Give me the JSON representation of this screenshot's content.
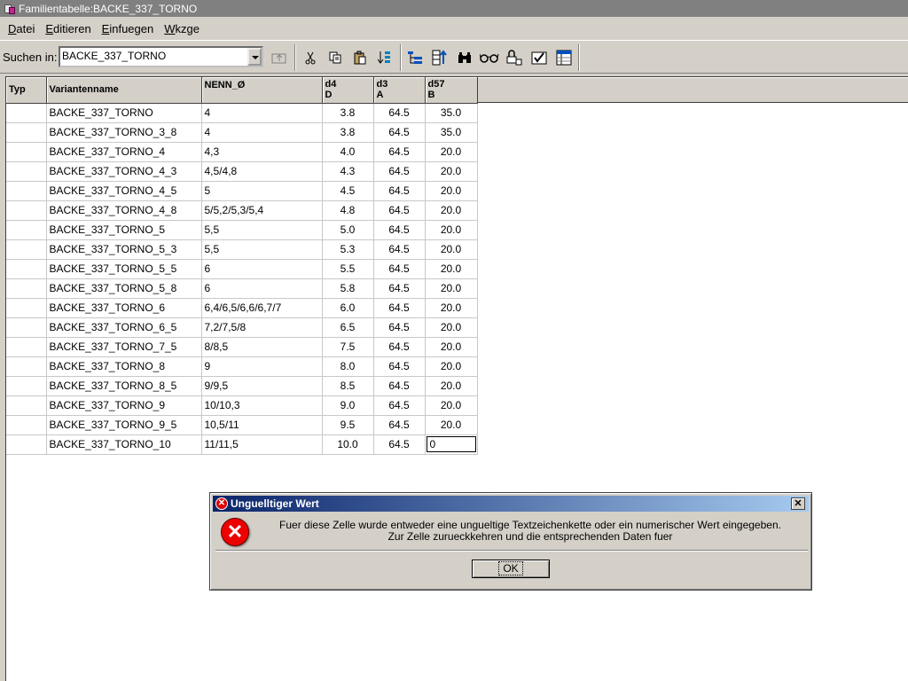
{
  "window": {
    "title": "Familientabelle:BACKE_337_TORNO"
  },
  "menu": [
    {
      "label": "Datei"
    },
    {
      "label": "Editieren"
    },
    {
      "label": "Einfuegen"
    },
    {
      "label": "Wkzge"
    }
  ],
  "toolbar": {
    "search_label": "Suchen in:",
    "search_value": "BACKE_337_TORNO",
    "icons": [
      "folder-up-icon",
      "cut-icon",
      "copy-icon",
      "paste-icon",
      "fill-down-icon",
      "tree-icon",
      "sort-icon",
      "binoculars-icon",
      "glasses-icon",
      "lock-icon",
      "verify-icon",
      "table-icon"
    ]
  },
  "table": {
    "headers": {
      "typ": "Typ",
      "name": "Variantenname",
      "nenn": "NENN_Ø",
      "d4": {
        "top": "d4",
        "bottom": "D"
      },
      "d3": {
        "top": "d3",
        "bottom": "A"
      },
      "d57": {
        "top": "d57",
        "bottom": "B"
      }
    },
    "rows": [
      {
        "typ": "",
        "name": "BACKE_337_TORNO",
        "nenn": "4",
        "d4": "3.8",
        "d3": "64.5",
        "d57": "35.0"
      },
      {
        "typ": "",
        "name": "BACKE_337_TORNO_3_8",
        "nenn": "4",
        "d4": "3.8",
        "d3": "64.5",
        "d57": "35.0"
      },
      {
        "typ": "",
        "name": "BACKE_337_TORNO_4",
        "nenn": "4,3",
        "d4": "4.0",
        "d3": "64.5",
        "d57": "20.0"
      },
      {
        "typ": "",
        "name": "BACKE_337_TORNO_4_3",
        "nenn": "4,5/4,8",
        "d4": "4.3",
        "d3": "64.5",
        "d57": "20.0"
      },
      {
        "typ": "",
        "name": "BACKE_337_TORNO_4_5",
        "nenn": "5",
        "d4": "4.5",
        "d3": "64.5",
        "d57": "20.0"
      },
      {
        "typ": "",
        "name": "BACKE_337_TORNO_4_8",
        "nenn": "5/5,2/5,3/5,4",
        "d4": "4.8",
        "d3": "64.5",
        "d57": "20.0"
      },
      {
        "typ": "",
        "name": "BACKE_337_TORNO_5",
        "nenn": "5,5",
        "d4": "5.0",
        "d3": "64.5",
        "d57": "20.0"
      },
      {
        "typ": "",
        "name": "BACKE_337_TORNO_5_3",
        "nenn": "5,5",
        "d4": "5.3",
        "d3": "64.5",
        "d57": "20.0"
      },
      {
        "typ": "",
        "name": "BACKE_337_TORNO_5_5",
        "nenn": "6",
        "d4": "5.5",
        "d3": "64.5",
        "d57": "20.0"
      },
      {
        "typ": "",
        "name": "BACKE_337_TORNO_5_8",
        "nenn": "6",
        "d4": "5.8",
        "d3": "64.5",
        "d57": "20.0"
      },
      {
        "typ": "",
        "name": "BACKE_337_TORNO_6",
        "nenn": "6,4/6,5/6,6/6,7/7",
        "d4": "6.0",
        "d3": "64.5",
        "d57": "20.0"
      },
      {
        "typ": "",
        "name": "BACKE_337_TORNO_6_5",
        "nenn": "7,2/7,5/8",
        "d4": "6.5",
        "d3": "64.5",
        "d57": "20.0"
      },
      {
        "typ": "",
        "name": "BACKE_337_TORNO_7_5",
        "nenn": "8/8,5",
        "d4": "7.5",
        "d3": "64.5",
        "d57": "20.0"
      },
      {
        "typ": "",
        "name": "BACKE_337_TORNO_8",
        "nenn": "9",
        "d4": "8.0",
        "d3": "64.5",
        "d57": "20.0"
      },
      {
        "typ": "",
        "name": "BACKE_337_TORNO_8_5",
        "nenn": "9/9,5",
        "d4": "8.5",
        "d3": "64.5",
        "d57": "20.0"
      },
      {
        "typ": "",
        "name": "BACKE_337_TORNO_9",
        "nenn": "10/10,3",
        "d4": "9.0",
        "d3": "64.5",
        "d57": "20.0"
      },
      {
        "typ": "",
        "name": "BACKE_337_TORNO_9_5",
        "nenn": "10,5/11",
        "d4": "9.5",
        "d3": "64.5",
        "d57": "20.0"
      },
      {
        "typ": "",
        "name": "BACKE_337_TORNO_10",
        "nenn": "11/11,5",
        "d4": "10.0",
        "d3": "64.5",
        "d57": "0",
        "editing": true
      }
    ]
  },
  "dialog": {
    "title": "Unguelltiger Wert",
    "message_line1": "Fuer diese Zelle wurde entweder eine ungueltige Textzeichenkette oder ein numerischer Wert eingegeben.",
    "message_line2": "Zur Zelle zurueckkehren und die entsprechenden Daten fuer",
    "ok_label": "OK"
  }
}
